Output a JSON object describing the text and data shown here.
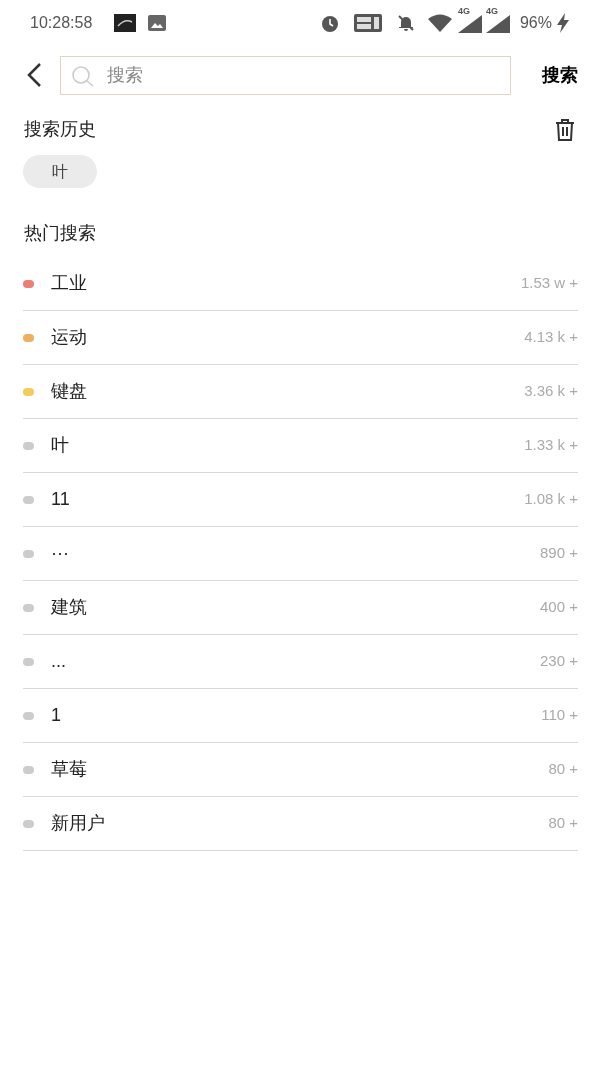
{
  "status_bar": {
    "time": "10:28:58",
    "signals": [
      {
        "label": "4G"
      },
      {
        "label": "4G"
      }
    ],
    "battery": "96%"
  },
  "search": {
    "placeholder": "搜索",
    "button": "搜索"
  },
  "history": {
    "title": "搜索历史",
    "items": [
      {
        "label": "叶"
      }
    ]
  },
  "hot": {
    "title": "热门搜索",
    "items": [
      {
        "label": "工业",
        "count": "1.53 w +",
        "color": "#ec7f74"
      },
      {
        "label": "运动",
        "count": "4.13 k +",
        "color": "#edb063"
      },
      {
        "label": "键盘",
        "count": "3.36 k +",
        "color": "#f2cc5e"
      },
      {
        "label": "叶",
        "count": "1.33 k +",
        "color": "#cccccc"
      },
      {
        "label": "11",
        "count": "1.08 k +",
        "color": "#cccccc"
      },
      {
        "label": "···",
        "count": "890 +",
        "color": "#cccccc"
      },
      {
        "label": "建筑",
        "count": "400 +",
        "color": "#cccccc"
      },
      {
        "label": "...",
        "count": "230 +",
        "color": "#cccccc"
      },
      {
        "label": "1",
        "count": "110 +",
        "color": "#cccccc"
      },
      {
        "label": "草莓",
        "count": "80 +",
        "color": "#cccccc"
      },
      {
        "label": "新用户",
        "count": "80 +",
        "color": "#cccccc"
      }
    ]
  }
}
